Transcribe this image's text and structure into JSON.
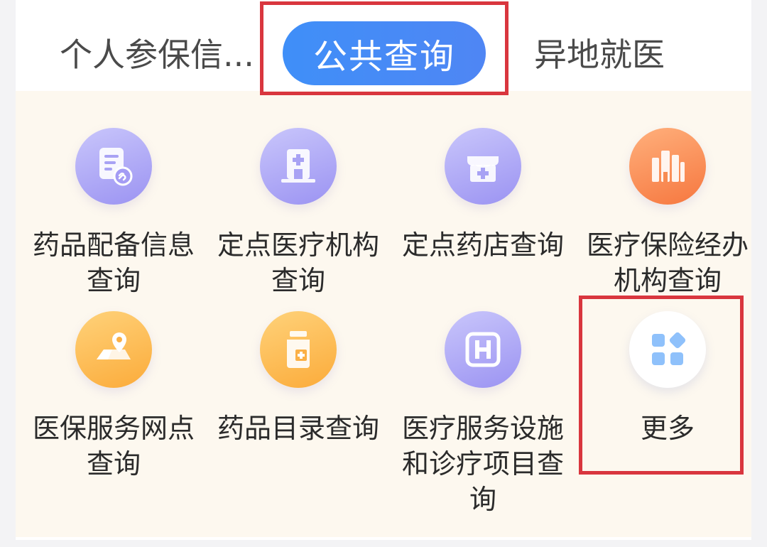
{
  "tabs": [
    {
      "label": "个人参保信..."
    },
    {
      "label": "公共查询"
    },
    {
      "label": "异地就医"
    }
  ],
  "grid": {
    "items": [
      {
        "label": "药品配备信息查询",
        "icon": "document-link-icon"
      },
      {
        "label": "定点医疗机构查询",
        "icon": "hospital-building-icon"
      },
      {
        "label": "定点药店查询",
        "icon": "pharmacy-store-icon"
      },
      {
        "label": "医疗保险经办机构查询",
        "icon": "office-buildings-icon"
      },
      {
        "label": "医保服务网点查询",
        "icon": "map-pin-icon"
      },
      {
        "label": "药品目录查询",
        "icon": "medicine-bottle-icon"
      },
      {
        "label": "医疗服务设施和诊疗项目查询",
        "icon": "h-sign-icon"
      },
      {
        "label": "更多",
        "icon": "app-grid-icon"
      }
    ]
  },
  "colors": {
    "tab_active_bg": "#4a8af6",
    "highlight": "#d9363e",
    "grid_bg": "#fdf8ef"
  }
}
